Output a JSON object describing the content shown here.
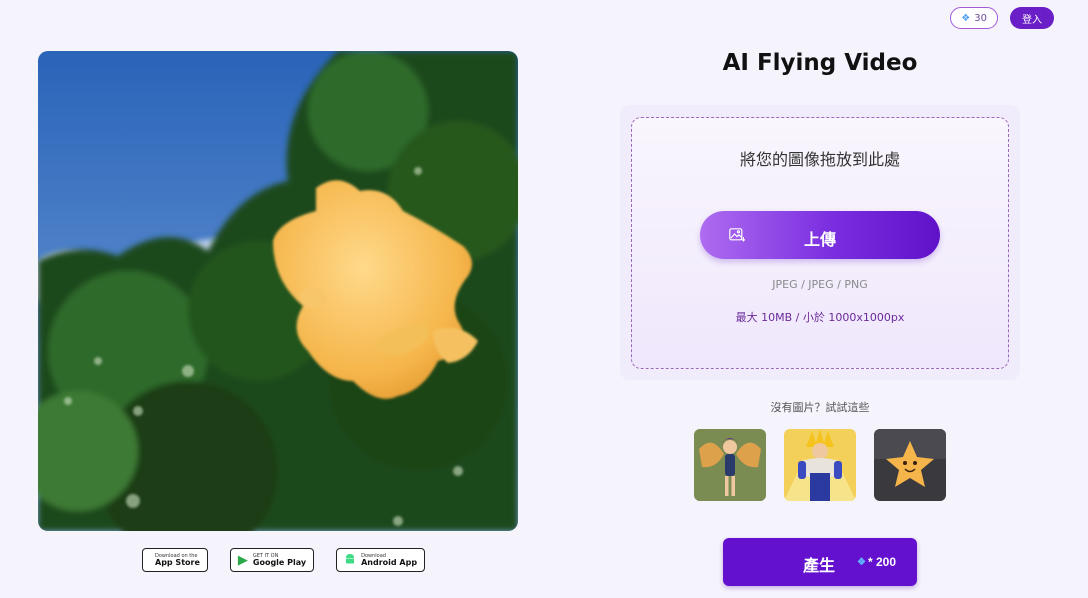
{
  "topbar": {
    "credits": "30",
    "login_label": "登入"
  },
  "stores": {
    "apple": {
      "small": "Download on the",
      "big": "App Store"
    },
    "google": {
      "small": "GET IT ON",
      "big": "Google Play"
    },
    "android": {
      "small": "Download",
      "big": "Android App"
    }
  },
  "main": {
    "title": "AI Flying Video",
    "drop_text": "將您的圖像拖放到此處",
    "upload_label": "上傳",
    "formats": "JPEG / JPEG / PNG",
    "limits": "最大 10MB / 小於 1000x1000px",
    "samples_label": "沒有圖片？試試這些",
    "generate_label": "產生",
    "generate_cost": "* 200"
  },
  "colors": {
    "accent": "#6410cf",
    "upload_gradient_start": "#ad6cf0",
    "background": "#f5f3fb"
  },
  "icons": {
    "credits": "diamond-icon",
    "upload": "image-upload-icon",
    "apple": "apple-icon",
    "google": "google-play-icon",
    "android": "android-icon"
  }
}
